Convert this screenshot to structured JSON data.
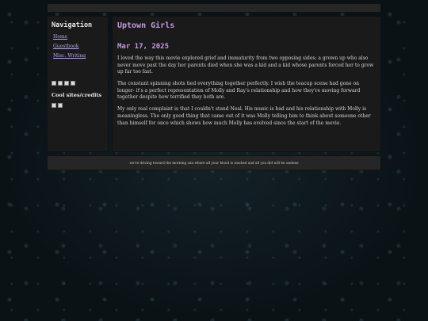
{
  "sidebar": {
    "heading": "Navigation",
    "links": [
      "Home",
      "Guestbook",
      "Misc. Writing"
    ],
    "cool_heading": "Cool sites/credits"
  },
  "main": {
    "title": "Uptown Girls",
    "date": "Mar 17, 2025",
    "paragraphs": [
      "I loved the way this movie explored grief and immaturity from two opposing sides; a grown up who also never move past the day her parents died when she was a kid and a kid whose parents forced her to grow up far too fast.",
      "The constant spinning shots tied everything together perfectly. I wish the teacup scene had gone on longer- it's a perfect representation of Molly and Ray's relationship and how they're moving forward together despite how terrified they both are.",
      "My only real complaint is that I couldn't stand Neal. His music is bad and his relationship with Molly is meaningless. The only good thing that came out of it was Molly telling him to think about someone other than himself for once which shows how much Molly has evolved since the start of the movie."
    ]
  },
  "footer": {
    "text": "we're driving toward the morning sun where all your blood is washed and all you did will be undone"
  }
}
